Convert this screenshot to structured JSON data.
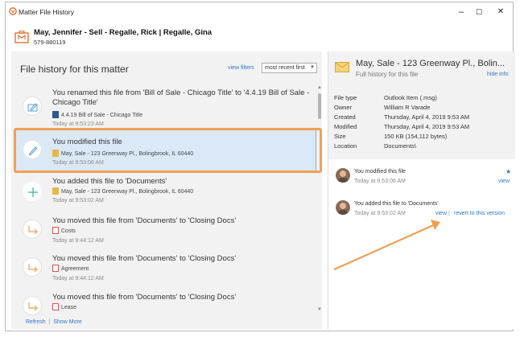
{
  "window": {
    "title": "Matter File History",
    "controls": {
      "minimize": "–",
      "maximize": "☐",
      "close": "✕"
    }
  },
  "matter": {
    "name": "May, Jennifer - Sell - Regalle, Rick | Regalle, Gina",
    "number": "579-880119",
    "icon": "briefcase-icon"
  },
  "history": {
    "title": "File history for this matter",
    "view_filters": "view filters",
    "sort": "most recent first",
    "items": [
      {
        "icon": "rename-icon",
        "message": "You renamed this file from 'Bill of Sale - Chicago Title' to '4.4.19 Bill of Sale - Chicago Title'",
        "file": "4.4.19 Bill of Sale - Chicago Title",
        "time": "Today at 9:53:23 AM"
      },
      {
        "icon": "pencil-icon",
        "message": "You modified this file",
        "file": "May, Sale - 123 Greenway Pl., Bolingbrook, IL 60440",
        "time": "Today at 9:53:06 AM",
        "selected": true
      },
      {
        "icon": "plus-icon",
        "message": "You added this file to 'Documents'",
        "file": "May, Sale - 123 Greenway Pl., Bolingbrook, IL 60440",
        "time": "Today at 9:53:02 AM"
      },
      {
        "icon": "move-arrow-icon",
        "message": "You moved this file from 'Documents' to 'Closing Docs'",
        "file": "Costs",
        "time": "Today at 9:44:12 AM"
      },
      {
        "icon": "move-arrow-icon",
        "message": "You moved this file from 'Documents' to 'Closing Docs'",
        "file": "Agreement",
        "time": "Today at 9:44:12 AM"
      },
      {
        "icon": "move-arrow-icon",
        "message": "You moved this file from 'Documents' to 'Closing Docs'",
        "file": "Lease",
        "time": ""
      }
    ],
    "footer": {
      "refresh": "Refresh",
      "sep": "|",
      "show_more": "Show More"
    }
  },
  "details": {
    "title": "May, Sale - 123 Greenway Pl., Bolin...",
    "subtitle": "Full history for this file",
    "hide_info": "hide info",
    "properties": [
      {
        "key": "File type",
        "value": "Outlook Item (.msg)"
      },
      {
        "key": "Owner",
        "value": "William R Varade"
      },
      {
        "key": "Created",
        "value": "Thursday, April 4, 2019 9:53 AM"
      },
      {
        "key": "Modified",
        "value": "Thursday, April 4, 2019 9:53 AM"
      },
      {
        "key": "Size",
        "value": "150 KB (154,112 bytes)"
      },
      {
        "key": "Location",
        "value": "Documents\\"
      }
    ],
    "versions": [
      {
        "message": "You modified this file",
        "time": "Today at 9:53:06 AM",
        "view": "view",
        "star": "★"
      },
      {
        "message": "You added this file to 'Documents'",
        "time": "Today at 9:53:02 AM",
        "view": "view",
        "sep": "|",
        "revert": "revert to this version"
      }
    ]
  },
  "colors": {
    "accent": "#2f78c4",
    "highlight": "#f0a055",
    "selected_bg": "#dbe9f7"
  }
}
